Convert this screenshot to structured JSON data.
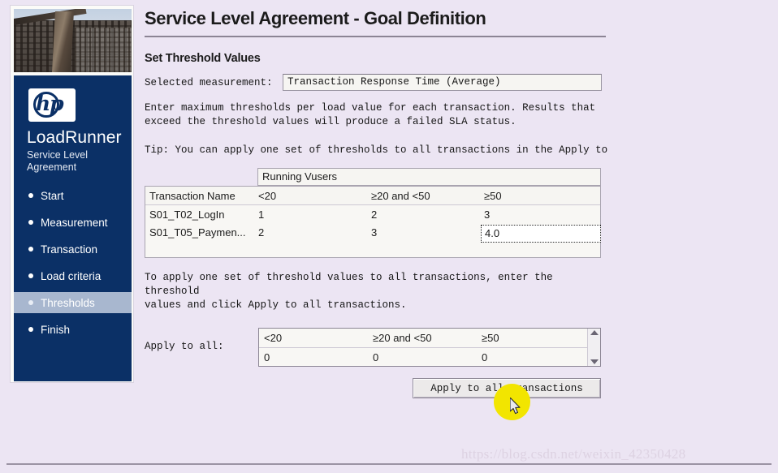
{
  "sidebar": {
    "photo_alt": "roller-coaster-photo",
    "logo": "hp-logo",
    "logo_text": "hp",
    "brand": "LoadRunner",
    "brand_sub": "Service Level\nAgreement",
    "brand_sub_line1": "Service Level",
    "brand_sub_line2": "Agreement",
    "items": [
      {
        "label": "Start",
        "active": false
      },
      {
        "label": "Measurement",
        "active": false
      },
      {
        "label": "Transaction",
        "active": false
      },
      {
        "label": "Load criteria",
        "active": false
      },
      {
        "label": "Thresholds",
        "active": true
      },
      {
        "label": "Finish",
        "active": false
      }
    ],
    "bg_color": "#0b3066",
    "active_color": "#a8b7cf"
  },
  "header": {
    "title": "Service Level Agreement - Goal Definition",
    "section_title": "Set Threshold Values"
  },
  "measurement": {
    "label": "Selected measurement:",
    "value": "Transaction Response Time (Average)"
  },
  "paragraphs": {
    "instructions_line1": "Enter maximum thresholds per load value for each transaction. Results that",
    "instructions_line2": "exceed the threshold values will produce a failed SLA status.",
    "tip": "Tip: You can apply one set of thresholds to all transactions in the Apply to",
    "apply_line1": "To apply one set of threshold values to all transactions, enter the threshold",
    "apply_line2": "values and click Apply to all transactions."
  },
  "grid": {
    "group_header": "Running Vusers",
    "columns": [
      "Transaction Name",
      "<20",
      "≥20 and <50",
      "≥50"
    ],
    "rows": [
      {
        "name": "S01_T02_LogIn",
        "lt20": "1",
        "mid": "2",
        "ge50": "3",
        "editing": false
      },
      {
        "name": "S01_T05_Paymen...",
        "lt20": "2",
        "mid": "3",
        "ge50": "4.0",
        "editing": true
      }
    ]
  },
  "apply_to_all": {
    "label": "Apply to all:",
    "columns": [
      "<20",
      "≥20 and <50",
      "≥50"
    ],
    "values": [
      "0",
      "0",
      "0"
    ],
    "button_label": "Apply to all transactions",
    "scroll_up_icon": "triangle-up-icon",
    "scroll_down_icon": "triangle-down-icon"
  },
  "overlay": {
    "cursor_icon": "mouse-pointer-icon",
    "highlight_color": "#f2e500",
    "watermark": "https://blog.csdn.net/weixin_42350428"
  }
}
